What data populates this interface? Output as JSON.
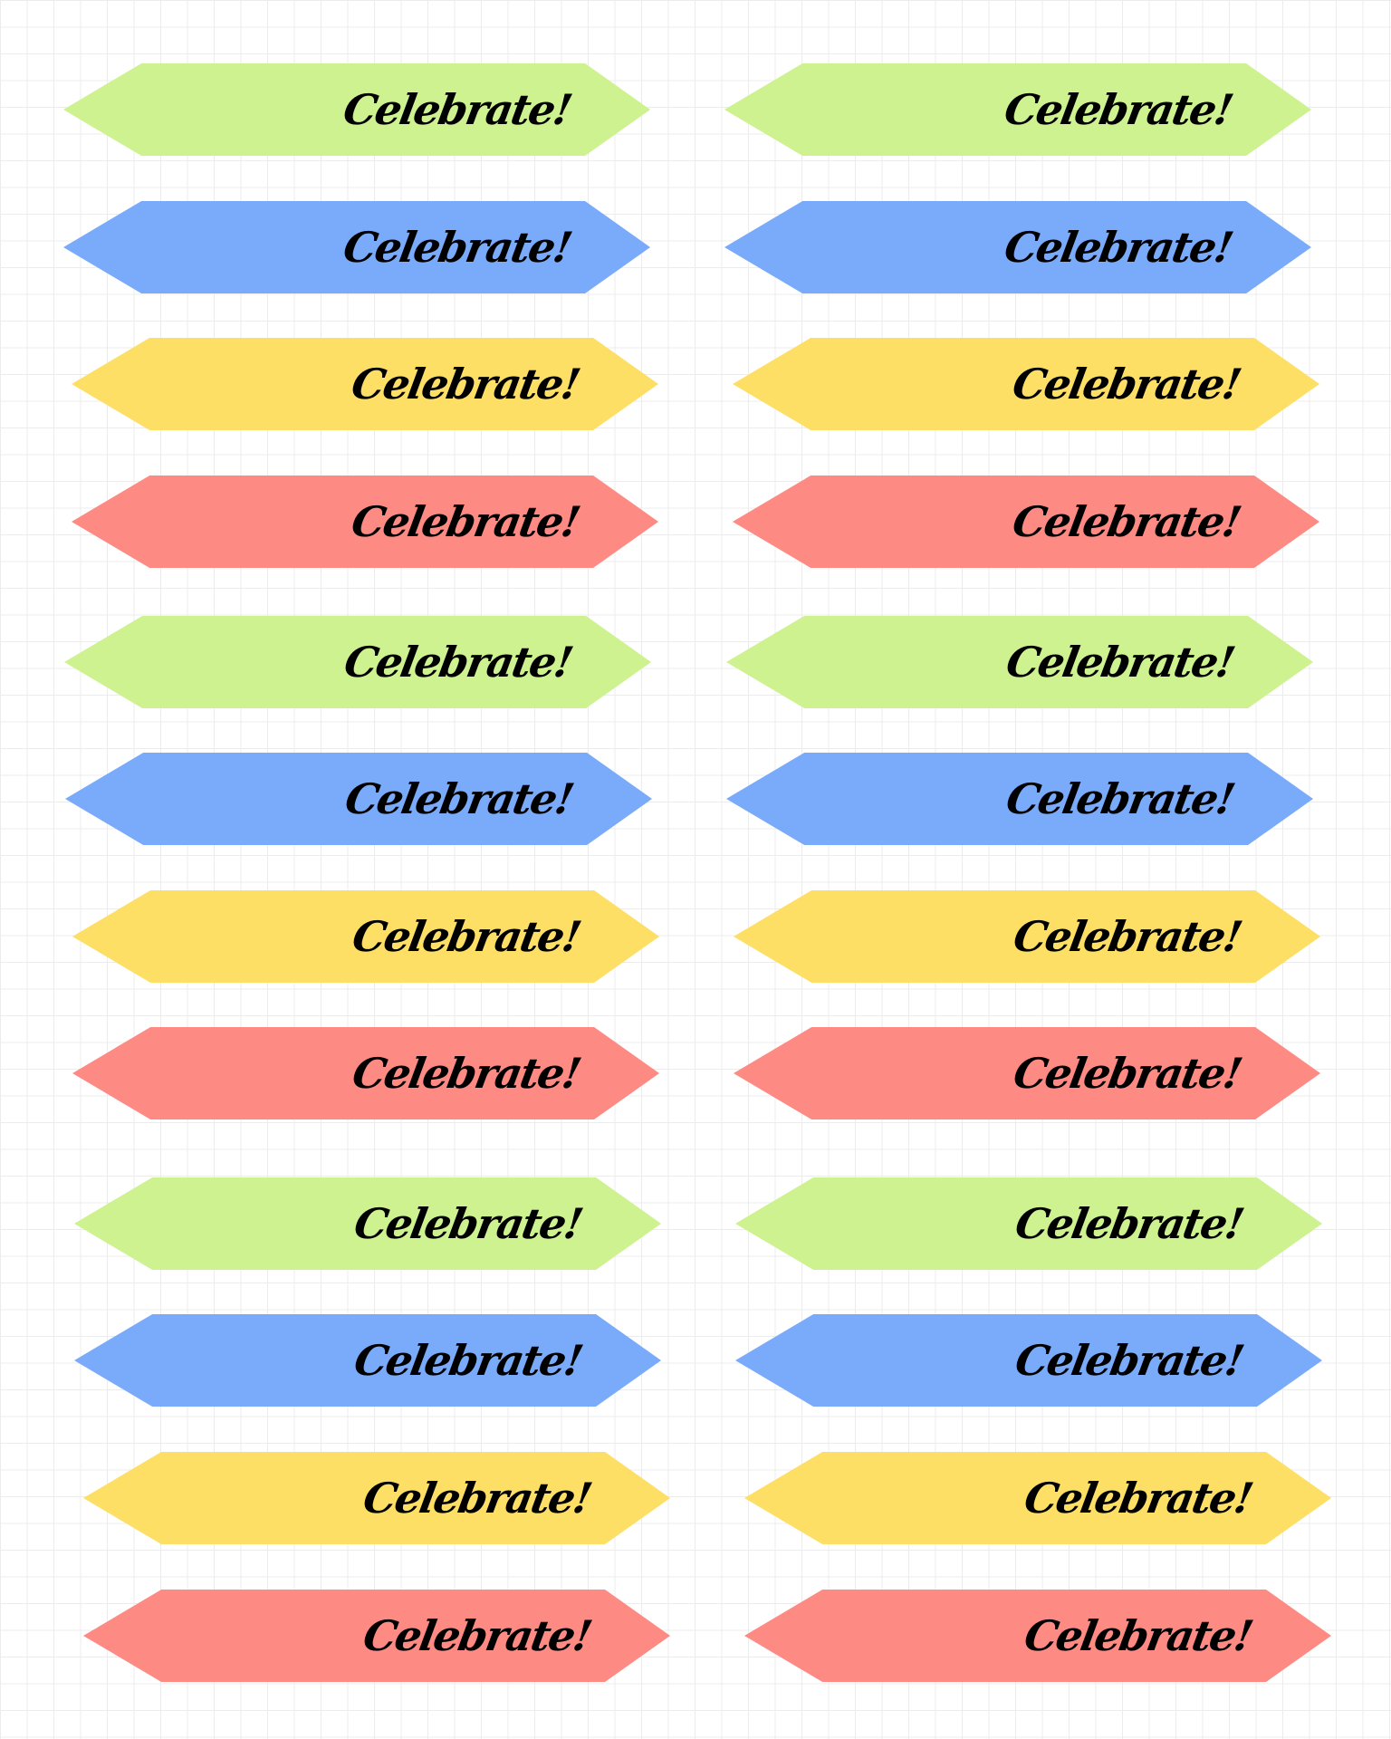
{
  "label_text": "Celebrate!",
  "palette": {
    "green": "#cdf28f",
    "blue": "#7aaafa",
    "yellow": "#fddf66",
    "red": "#fe8a84"
  },
  "columns": [
    {
      "labels": [
        {
          "text": "Celebrate!",
          "color": "green"
        },
        {
          "text": "Celebrate!",
          "color": "blue"
        },
        {
          "text": "Celebrate!",
          "color": "yellow"
        },
        {
          "text": "Celebrate!",
          "color": "red"
        },
        {
          "text": "Celebrate!",
          "color": "green"
        },
        {
          "text": "Celebrate!",
          "color": "blue"
        },
        {
          "text": "Celebrate!",
          "color": "yellow"
        },
        {
          "text": "Celebrate!",
          "color": "red"
        },
        {
          "text": "Celebrate!",
          "color": "green"
        },
        {
          "text": "Celebrate!",
          "color": "blue"
        },
        {
          "text": "Celebrate!",
          "color": "yellow"
        },
        {
          "text": "Celebrate!",
          "color": "red"
        }
      ]
    },
    {
      "labels": [
        {
          "text": "Celebrate!",
          "color": "green"
        },
        {
          "text": "Celebrate!",
          "color": "blue"
        },
        {
          "text": "Celebrate!",
          "color": "yellow"
        },
        {
          "text": "Celebrate!",
          "color": "red"
        },
        {
          "text": "Celebrate!",
          "color": "green"
        },
        {
          "text": "Celebrate!",
          "color": "blue"
        },
        {
          "text": "Celebrate!",
          "color": "yellow"
        },
        {
          "text": "Celebrate!",
          "color": "red"
        },
        {
          "text": "Celebrate!",
          "color": "green"
        },
        {
          "text": "Celebrate!",
          "color": "blue"
        },
        {
          "text": "Celebrate!",
          "color": "yellow"
        },
        {
          "text": "Celebrate!",
          "color": "red"
        }
      ]
    }
  ]
}
